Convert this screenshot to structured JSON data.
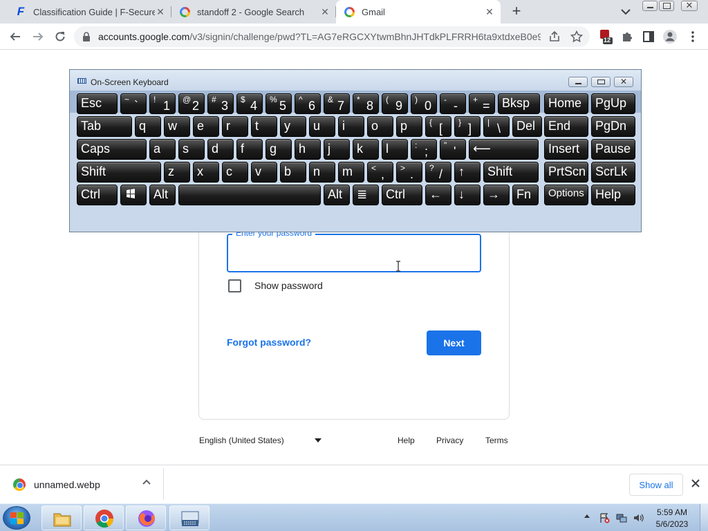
{
  "browser": {
    "tabs": [
      {
        "title": "Classification Guide | F-Secure",
        "favicon": "fsecure-icon",
        "active": false
      },
      {
        "title": "standoff 2 - Google Search",
        "favicon": "google-icon",
        "active": false
      },
      {
        "title": "Gmail",
        "favicon": "google-icon",
        "active": true
      }
    ],
    "url_host": "accounts.google.com",
    "url_path": "/v3/signin/challenge/pwd?TL=AG7eRGCXYtwmBhnJHTdkPLFRRH6ta9xtdxeB0e9L...",
    "extension_badge": "12"
  },
  "osk": {
    "title": "On-Screen Keyboard",
    "rows": [
      [
        {
          "l": "Esc"
        },
        {
          "t": "~",
          "b": "`"
        },
        {
          "t": "!",
          "b": "1"
        },
        {
          "t": "@",
          "b": "2"
        },
        {
          "t": "#",
          "b": "3"
        },
        {
          "t": "$",
          "b": "4"
        },
        {
          "t": "%",
          "b": "5"
        },
        {
          "t": "^",
          "b": "6"
        },
        {
          "t": "&",
          "b": "7"
        },
        {
          "t": "*",
          "b": "8"
        },
        {
          "t": "(",
          "b": "9"
        },
        {
          "t": ")",
          "b": "0"
        },
        {
          "t": "-",
          "b": "-"
        },
        {
          "t": "+",
          "b": "="
        },
        {
          "l": "Bksp"
        },
        {
          "l": "Home"
        },
        {
          "l": "PgUp"
        }
      ],
      [
        {
          "l": "Tab"
        },
        {
          "l": "q"
        },
        {
          "l": "w"
        },
        {
          "l": "e"
        },
        {
          "l": "r"
        },
        {
          "l": "t"
        },
        {
          "l": "y"
        },
        {
          "l": "u"
        },
        {
          "l": "i"
        },
        {
          "l": "o"
        },
        {
          "l": "p"
        },
        {
          "t": "{",
          "b": "["
        },
        {
          "t": "}",
          "b": "]"
        },
        {
          "t": "|",
          "b": "\\"
        },
        {
          "l": "Del"
        },
        {
          "l": "End"
        },
        {
          "l": "PgDn"
        }
      ],
      [
        {
          "l": "Caps"
        },
        {
          "l": "a"
        },
        {
          "l": "s"
        },
        {
          "l": "d"
        },
        {
          "l": "f"
        },
        {
          "l": "g"
        },
        {
          "l": "h"
        },
        {
          "l": "j"
        },
        {
          "l": "k"
        },
        {
          "l": "l"
        },
        {
          "t": ":",
          "b": ";"
        },
        {
          "t": "\"",
          "b": "'"
        },
        {
          "l": "⟵"
        },
        {
          "l": "Insert"
        },
        {
          "l": "Pause"
        }
      ],
      [
        {
          "l": "Shift"
        },
        {
          "l": "z"
        },
        {
          "l": "x"
        },
        {
          "l": "c"
        },
        {
          "l": "v"
        },
        {
          "l": "b"
        },
        {
          "l": "n"
        },
        {
          "l": "m"
        },
        {
          "t": "<",
          "b": ","
        },
        {
          "t": ">",
          "b": "."
        },
        {
          "t": "?",
          "b": "/"
        },
        {
          "l": "↑"
        },
        {
          "l": "Shift"
        },
        {
          "l": "PrtScn"
        },
        {
          "l": "ScrLk"
        }
      ],
      [
        {
          "l": "Ctrl"
        },
        {
          "l": "",
          "icon": "windows"
        },
        {
          "l": "Alt"
        },
        {
          "l": ""
        },
        {
          "l": "Alt"
        },
        {
          "l": "≣"
        },
        {
          "l": "Ctrl"
        },
        {
          "l": "←"
        },
        {
          "l": "↓"
        },
        {
          "l": "→"
        },
        {
          "l": "Fn"
        },
        {
          "l": "Options"
        },
        {
          "l": "Help"
        }
      ]
    ]
  },
  "signin": {
    "password_label": "Enter your password",
    "password_value": "",
    "show_password_label": "Show password",
    "show_password_checked": false,
    "forgot_label": "Forgot password?",
    "next_label": "Next",
    "language": "English (United States)",
    "footer_links": [
      "Help",
      "Privacy",
      "Terms"
    ]
  },
  "downloads": {
    "file_name": "unnamed.webp",
    "show_all_label": "Show all"
  },
  "taskbar": {
    "apps": [
      {
        "name": "file-explorer-taskbar-button",
        "icon": "folder-icon"
      },
      {
        "name": "chrome-taskbar-button",
        "icon": "chrome-icon"
      },
      {
        "name": "firefox-taskbar-button",
        "icon": "firefox-icon"
      },
      {
        "name": "on-screen-keyboard-taskbar-button",
        "icon": "keyboard-icon"
      }
    ],
    "time": "5:59 AM",
    "date": "5/6/2023"
  },
  "colors": {
    "accent": "#1a73e8",
    "tab_strip": "#dee1e6",
    "osk_frame": "#a7bbd3",
    "key_face": "#1d1d1d",
    "taskbar": "#b6cde8"
  }
}
